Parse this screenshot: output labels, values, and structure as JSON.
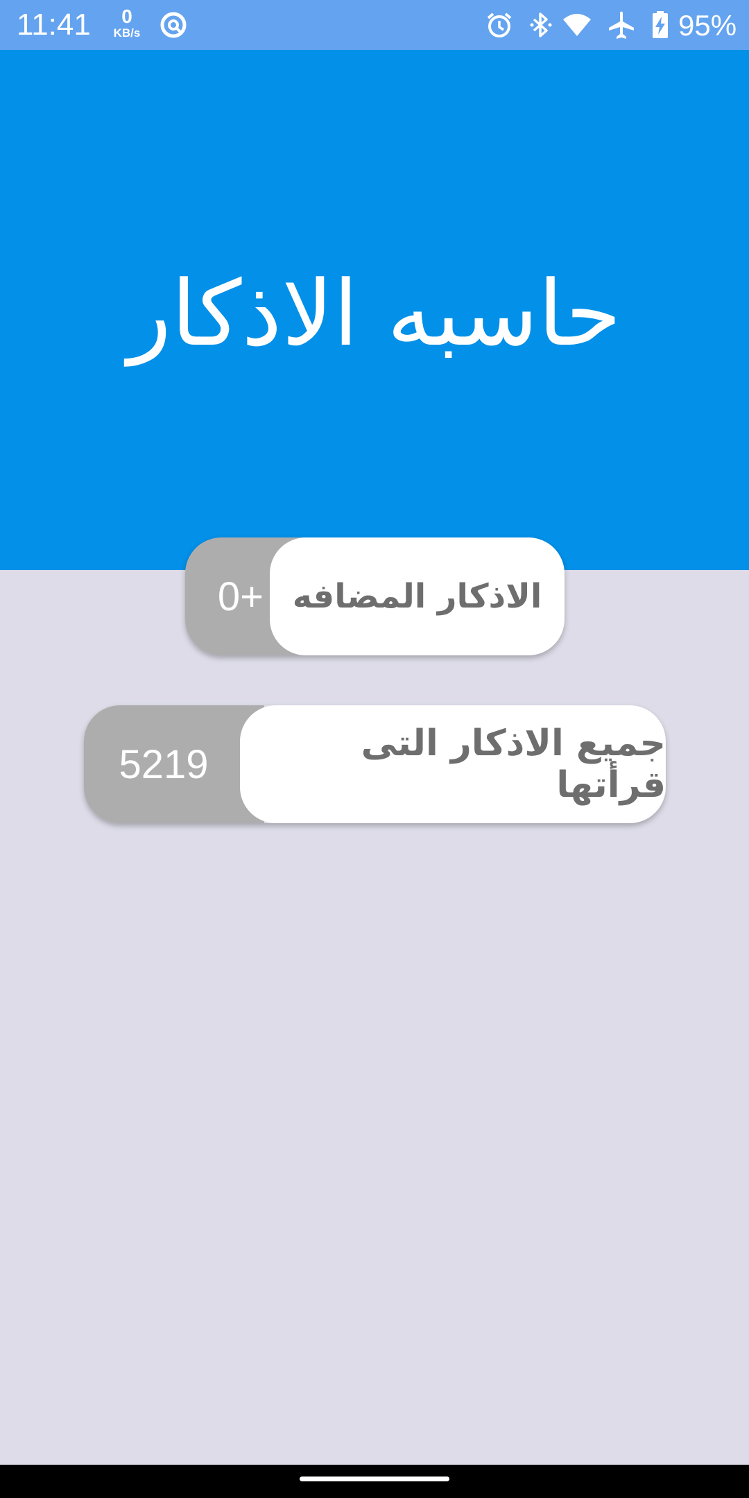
{
  "status_bar": {
    "time": "11:41",
    "net_speed_value": "0",
    "net_speed_unit": "KB/s",
    "battery_percent": "95%",
    "icons": [
      "data-saver-icon",
      "alarm-icon",
      "bluetooth-icon",
      "wifi-icon",
      "airplane-icon",
      "battery-charging-icon"
    ],
    "background_color": "#64a3f0"
  },
  "header": {
    "title": "حاسبه الاذكار",
    "background_color": "#0390e8"
  },
  "counters": {
    "added": {
      "count": "0+",
      "label": "الاذكار المضافه"
    },
    "total": {
      "count": "5219",
      "label": "جميع الاذكار التى قرأتها"
    }
  },
  "colors": {
    "page_background": "#dddce8",
    "count_background": "#adadad",
    "label_background": "#ffffff",
    "label_text": "#6e6e6e"
  }
}
